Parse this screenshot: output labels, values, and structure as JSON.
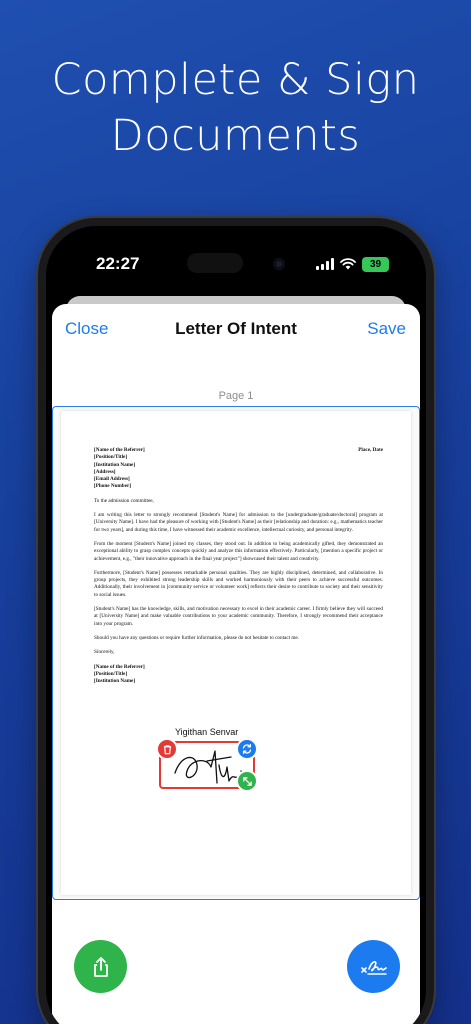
{
  "headline": {
    "line1": "Complete & Sign",
    "line2": "Documents"
  },
  "status_bar": {
    "time": "22:27",
    "battery": "39",
    "icons": [
      "signal-icon",
      "wifi-icon",
      "battery-icon"
    ]
  },
  "nav": {
    "close_label": "Close",
    "title": "Letter Of Intent",
    "save_label": "Save"
  },
  "page_label": "Page 1",
  "letter": {
    "header_left": [
      "[Name of the Referrer]",
      "[Position/Title]",
      "[Institution Name]",
      "[Address]",
      "[Email Address]",
      "[Phone Number]"
    ],
    "header_right": "Place, Date",
    "salutation": "To the admission committee,",
    "p1": "I am writing this letter to strongly recommend [Student's Name] for admission to the [undergraduate/graduate/doctoral] program at [University Name]. I have had the pleasure of working with [Student's Name] as their [relationship and duration: e.g., mathematics teacher for two years], and during this time, I have witnessed their academic excellence, intellectual curiosity, and personal integrity.",
    "p2": "From the moment [Student's Name] joined my classes, they stood out. In addition to being academically gifted, they demonstrated an exceptional ability to grasp complex concepts quickly and analyze this information effectively. Particularly, [mention a specific project or achievement, e.g., \"their innovative approach in the final year project\"] showcased their talent and creativity.",
    "p3": "Furthermore, [Student's Name] possesses remarkable personal qualities. They are highly disciplined, determined, and collaborative. In group projects, they exhibited strong leadership skills and worked harmoniously with their peers to achieve successful outcomes. Additionally, their involvement in [community service or volunteer work] reflects their desire to contribute to society and their sensitivity to social issues.",
    "p4": "[Student's Name] has the knowledge, skills, and motivation necessary to excel in their academic career. I firmly believe they will succeed at [University Name] and make valuable contributions to your academic community. Therefore, I strongly recommend their acceptance into your program.",
    "p5": "Should you have any questions or require further information, please do not hesitate to contact me.",
    "closing": "Sincerely,",
    "footer": [
      "[Name of the Referrer]",
      "[Position/Title]",
      "[Institution Name]"
    ]
  },
  "signature": {
    "name": "Yigithan Senvar",
    "icons": [
      "trash-icon",
      "rotate-icon",
      "resize-icon"
    ]
  },
  "fabs": {
    "share_icon": "share-icon",
    "sign_icon": "signature-icon"
  },
  "colors": {
    "accent": "#1d7bf0",
    "delete": "#e53935",
    "confirm": "#2fb34b",
    "background": "#1a45a4"
  }
}
